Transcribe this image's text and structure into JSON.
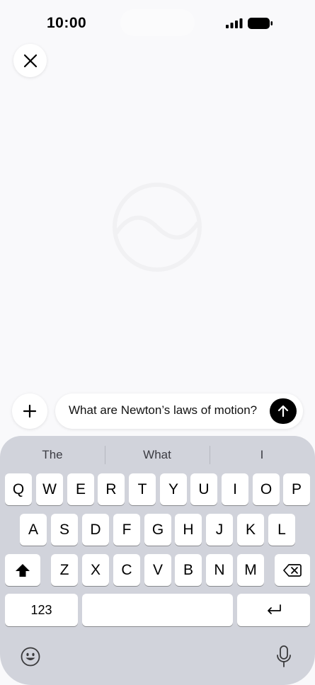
{
  "status_bar": {
    "time": "10:00",
    "icons": [
      "cellular-signal-icon",
      "battery-icon"
    ]
  },
  "top": {
    "close_icon": "close-icon"
  },
  "center": {
    "logo_icon": "assistant-logo-icon"
  },
  "composer": {
    "add_icon": "plus-icon",
    "input_value": "What are Newton’s laws of motion?",
    "send_icon": "arrow-up-icon"
  },
  "keyboard": {
    "suggestions": [
      "The",
      "What",
      "I"
    ],
    "rows": [
      [
        "Q",
        "W",
        "E",
        "R",
        "T",
        "Y",
        "U",
        "I",
        "O",
        "P"
      ],
      [
        "A",
        "S",
        "D",
        "F",
        "G",
        "H",
        "J",
        "K",
        "L"
      ],
      [
        "Z",
        "X",
        "C",
        "V",
        "B",
        "N",
        "M"
      ]
    ],
    "numbers_label": "123",
    "space_label": "",
    "shift_icon": "shift-icon",
    "delete_icon": "delete-icon",
    "return_icon": "return-icon",
    "emoji_icon": "emoji-icon",
    "mic_icon": "microphone-icon"
  },
  "colors": {
    "background": "#f9f9fb",
    "keyboard": "#d1d3db",
    "send_button": "#000000"
  }
}
